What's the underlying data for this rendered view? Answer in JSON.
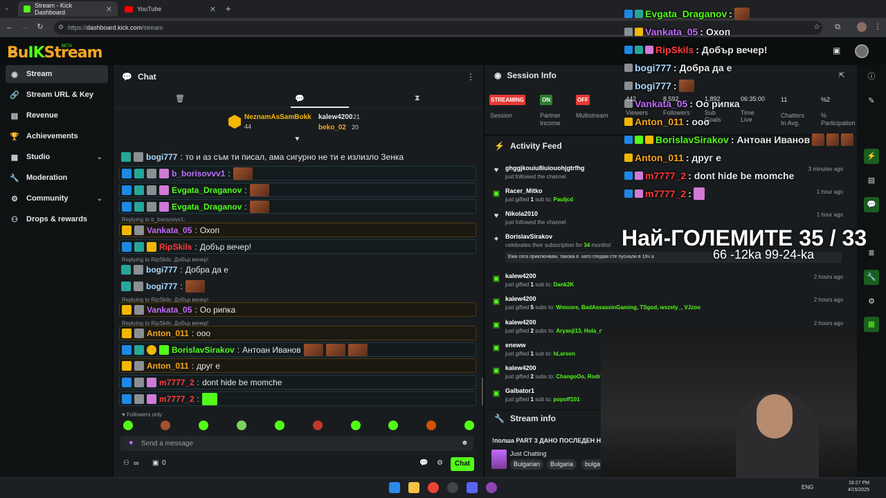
{
  "browser": {
    "tabs": [
      {
        "label": "Stream - Kick Dashboard"
      },
      {
        "label": "YouTube"
      }
    ],
    "url_prefix": "https://",
    "url_host": "dashboard.kick.com",
    "url_path": "/stream"
  },
  "logo": {
    "text_a": "Bu",
    "text_k": "IK",
    "text_b": "Stream",
    "tag": "BETA"
  },
  "sidebar": {
    "items": [
      {
        "label": "Stream",
        "icon": "stream-icon"
      },
      {
        "label": "Stream URL & Key",
        "icon": "link-icon"
      },
      {
        "label": "Revenue",
        "icon": "revenue-icon"
      },
      {
        "label": "Achievements",
        "icon": "trophy-icon"
      },
      {
        "label": "Studio",
        "icon": "studio-icon"
      },
      {
        "label": "Moderation",
        "icon": "wrench-icon"
      },
      {
        "label": "Community",
        "icon": "community-icon"
      },
      {
        "label": "Drops & rewards",
        "icon": "drops-icon"
      }
    ]
  },
  "chat": {
    "title": "Chat",
    "leader1": {
      "name": "NeznamAsSamBokk",
      "count": "44"
    },
    "leader2": {
      "name": "kalew4200",
      "count": "21"
    },
    "leader3": {
      "name": "beko_02",
      "count": "20"
    },
    "messages": [
      {
        "user": "bogi777",
        "color": "#a8d8ff",
        "text": "то и аз съм ти писал, ама сигурно не ти е излизло Зенка"
      },
      {
        "user": "b_borisovvv1",
        "color": "#c16bff",
        "text": ""
      },
      {
        "user": "Evgata_Draganov",
        "color": "#53fc18",
        "text": ""
      },
      {
        "user": "Evgata_Draganov",
        "color": "#53fc18",
        "text": ""
      },
      {
        "user": "Vankata_05",
        "color": "#c16bff",
        "text": "Охоп"
      },
      {
        "user": "RipSkils",
        "color": "#ff3b3b",
        "text": "Добър вечер!"
      },
      {
        "user": "bogi777",
        "color": "#a8d8ff",
        "text": "Добра да е"
      },
      {
        "user": "bogi777",
        "color": "#a8d8ff",
        "text": ""
      },
      {
        "user": "Vankata_05",
        "color": "#c16bff",
        "text": "Оо рипка"
      },
      {
        "user": "Anton_011",
        "color": "#f5a623",
        "text": "ооо"
      },
      {
        "user": "BorislavSirakov",
        "color": "#53fc18",
        "text": "Антоан Иванов"
      },
      {
        "user": "Anton_011",
        "color": "#f5a623",
        "text": "друг е"
      },
      {
        "user": "m7777_2",
        "color": "#ff3b3b",
        "text": "dont hide be momche"
      },
      {
        "user": "m7777_2",
        "color": "#ff3b3b",
        "text": ""
      }
    ],
    "replies": [
      "Replying to b_borisovvv1:",
      "Replying to RipSkils: Добър вечер!",
      "Replying to RipSkils: Добър вечер!",
      "Replying to RipSkils: Добър вечер!"
    ],
    "followers_only": "Followers only",
    "placeholder": "Send a message",
    "infinity": "∞",
    "zero": "0",
    "send_label": "Chat"
  },
  "session": {
    "title": "Session Info",
    "streaming": "STREAMING",
    "on": "ON",
    "off": "OFF",
    "labels": [
      "Session",
      "Partner Income",
      "Multistream",
      "Viewers",
      "Followers",
      "Sub Goals",
      "Time Live",
      "Chatters In Avg.",
      "% Participation"
    ],
    "values": [
      "442",
      "8,592",
      "1,892",
      "06:35:00",
      "11",
      "%2"
    ]
  },
  "activity": {
    "title": "Activity Feed",
    "items": [
      {
        "name": "ghggjkouiu8iuiouohjgtrfhg",
        "desc": "just followed the channel",
        "time": "3 minutes ago"
      },
      {
        "name": "Racer_Mitko",
        "desc_pre": "just gifted ",
        "n": "1",
        "desc_mid": " sub to: ",
        "to": "Pauljcd",
        "time": "1 hour ago"
      },
      {
        "name": "Nikola2010",
        "desc": "just followed the channel",
        "time": "1 hour ago"
      },
      {
        "name": "BorislavSirakov",
        "desc_pre": "celebrates their subscription for ",
        "n": "34",
        "desc_mid": " months!",
        "to": "",
        "note": "Еми сега приключвам, такова е. като гледам сте пуснали в 16ч а",
        "time": ""
      },
      {
        "name": "kalew4200",
        "desc_pre": "just gifted ",
        "n": "1",
        "desc_mid": " sub to: ",
        "to": "Dank2K",
        "time": "2 hours ago"
      },
      {
        "name": "kalew4200",
        "desc_pre": "just gifted ",
        "n": "5",
        "desc_mid": " subs to: ",
        "to": "Wmoore, BadAssassinGaming, TSgod, wxzely_, VJzoo",
        "time": "2 hours ago"
      },
      {
        "name": "kalew4200",
        "desc_pre": "just gifted ",
        "n": "2",
        "desc_mid": " subs to: ",
        "to": "Aryanji13, Hola_c",
        "time": "2 hours ago"
      },
      {
        "name": "eneww",
        "desc_pre": "just gifted ",
        "n": "1",
        "desc_mid": " sub to: ",
        "to": "hLarson",
        "time": ""
      },
      {
        "name": "kalew4200",
        "desc_pre": "just gifted ",
        "n": "2",
        "desc_mid": " subs to: ",
        "to": "ChangoOo, Rodri",
        "time": ""
      },
      {
        "name": "Galbator1",
        "desc_pre": "just gifted ",
        "n": "1",
        "desc_mid": " sub to: ",
        "to": "popoff101",
        "time": ""
      }
    ]
  },
  "streaminfo": {
    "title": "Stream info",
    "stream_title": "!полша PART 3 ДАНО ПОСЛЕДЕН Н",
    "category": "Just Chatting",
    "tags": [
      "Bulgarian",
      "Bulgaria",
      "bulga"
    ]
  },
  "overlay": {
    "lines": [
      {
        "user": "Evgata_Draganov",
        "color": "#53fc18",
        "text": " :"
      },
      {
        "user": "Vankata_05",
        "color": "#c16bff",
        "text": " : Охоп"
      },
      {
        "user": "RipSkils",
        "color": "#ff3b3b",
        "text": " : Добър вечер!"
      },
      {
        "user": "bogi777",
        "color": "#a8d8ff",
        "text": " : Добра да е"
      },
      {
        "user": "bogi777",
        "color": "#a8d8ff",
        "text": " :"
      },
      {
        "user": "Vankata_05",
        "color": "#c16bff",
        "text": " : Оо рипка"
      },
      {
        "user": "Anton_011",
        "color": "#f5a623",
        "text": " : ооо"
      },
      {
        "user": "BorislavSirakov",
        "color": "#53fc18",
        "text": " : Антоан Иванов"
      },
      {
        "user": "Anton_011",
        "color": "#f5a623",
        "text": " : друг е"
      },
      {
        "user": "m7777_2",
        "color": "#ff3b3b",
        "text": " : dont hide be momche"
      },
      {
        "user": "m7777_2",
        "color": "#ff3b3b",
        "text": " :"
      }
    ],
    "big_title": "Най-ГОЛЕМИТЕ 35 / 33",
    "subtitle": "66 -12ka 99-24-ka"
  },
  "taskbar": {
    "lang": "ENG",
    "time": "18:27 PM",
    "date": "4/15/2025"
  }
}
